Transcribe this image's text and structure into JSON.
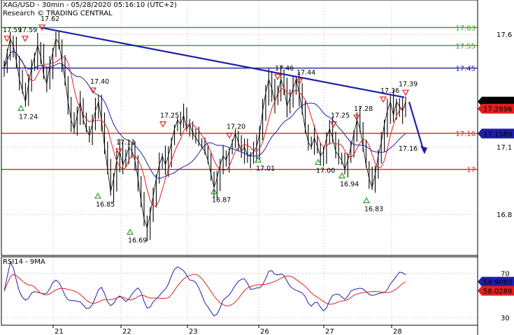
{
  "header": {
    "title": "XAG/USD - 30min - 05/28/2020 05:16:10 (UTC+2)",
    "credit": "Research © TRADING CENTRAL"
  },
  "chart_data": [
    {
      "type": "line",
      "name": "price",
      "y_ticks": [
        "17.6",
        "17.1",
        "16.8"
      ],
      "y_tick_values": [
        17.6,
        17.1,
        16.8
      ],
      "ylim": [
        16.63,
        17.74
      ],
      "x_ticks": [
        "21",
        "22",
        "23",
        "26",
        "27",
        "28"
      ],
      "levels": [
        {
          "label": "17.63",
          "value": 17.63,
          "color": "#2ca02c"
        },
        {
          "label": "17.55",
          "value": 17.55,
          "color": "#2ca02c"
        },
        {
          "label": "17.45",
          "value": 17.45,
          "color": "#1f1fa8"
        },
        {
          "label": "17.16",
          "value": 17.16,
          "color": "#e02020"
        },
        {
          "label": "17",
          "value": 17.0,
          "color": "#e02020"
        }
      ],
      "current_price": {
        "label": "17.301",
        "value": 17.301
      },
      "ma_fast": {
        "label": "17.2696",
        "value": 17.2696
      },
      "ma_slow": {
        "label": "17.1589",
        "value": 17.1589
      },
      "annotations": {
        "highs": [
          "17.59",
          "17.59",
          "17.62",
          "17.40",
          "17.25",
          "17.13",
          "17.20",
          "17.46",
          "17.44",
          "17.25",
          "17.28",
          "17.36",
          "17.39"
        ],
        "lows": [
          "17.24",
          "16.85",
          "16.69",
          "16.87",
          "17.01",
          "17.00",
          "16.94",
          "16.83"
        ],
        "target": "17.16"
      },
      "trendline": {
        "from": 17.63,
        "to": 17.32
      },
      "forecast": {
        "from": 17.3,
        "to": 17.08
      },
      "close_series": [
        17.45,
        17.52,
        17.58,
        17.55,
        17.48,
        17.4,
        17.35,
        17.3,
        17.38,
        17.45,
        17.5,
        17.55,
        17.5,
        17.42,
        17.38,
        17.46,
        17.52,
        17.58,
        17.56,
        17.48,
        17.4,
        17.3,
        17.22,
        17.18,
        17.24,
        17.3,
        17.22,
        17.18,
        17.15,
        17.2,
        17.26,
        17.3,
        17.22,
        17.1,
        17.0,
        16.9,
        16.96,
        17.04,
        17.08,
        17.02,
        17.05,
        17.1,
        17.08,
        17.04,
        16.96,
        16.86,
        16.78,
        16.74,
        16.8,
        16.88,
        16.96,
        17.02,
        17.06,
        17.02,
        17.06,
        17.12,
        17.18,
        17.22,
        17.2,
        17.24,
        17.18,
        17.2,
        17.16,
        17.14,
        17.12,
        17.1,
        17.08,
        17.04,
        16.98,
        16.92,
        16.96,
        17.02,
        17.06,
        17.04,
        17.08,
        17.12,
        17.16,
        17.12,
        17.08,
        17.1,
        17.06,
        17.06,
        17.08,
        17.1,
        17.16,
        17.26,
        17.34,
        17.4,
        17.36,
        17.3,
        17.34,
        17.4,
        17.36,
        17.28,
        17.32,
        17.36,
        17.4,
        17.34,
        17.26,
        17.18,
        17.12,
        17.1,
        17.14,
        17.1,
        17.06,
        17.08,
        17.14,
        17.18,
        17.14,
        17.08,
        17.06,
        17.04,
        17.0,
        17.04,
        17.1,
        17.16,
        17.22,
        17.18,
        17.1,
        17.02,
        16.96,
        16.92,
        16.98,
        17.06,
        17.12,
        17.2,
        17.26,
        17.3,
        17.24,
        17.3,
        17.28,
        17.26,
        17.3
      ]
    },
    {
      "type": "line",
      "name": "rsi",
      "title": "RSI14 - 9MA",
      "y_ticks": [
        "70",
        "30"
      ],
      "y_tick_values": [
        70,
        30
      ],
      "ylim": [
        23,
        85
      ],
      "rsi_value": {
        "label": "59.9083",
        "value": 59.9083
      },
      "ma_value": {
        "label": "58.0289",
        "value": 58.0289
      }
    }
  ],
  "colors": {
    "price": "#000000",
    "ma_fast": "#e02020",
    "ma_slow": "#1f1fa8",
    "support": "#e02020",
    "resistance": "#2ca02c",
    "trend": "#1f1fa8",
    "rsi": "#1f1fa8",
    "rsi_ma": "#e02020",
    "grid": "#888888"
  }
}
